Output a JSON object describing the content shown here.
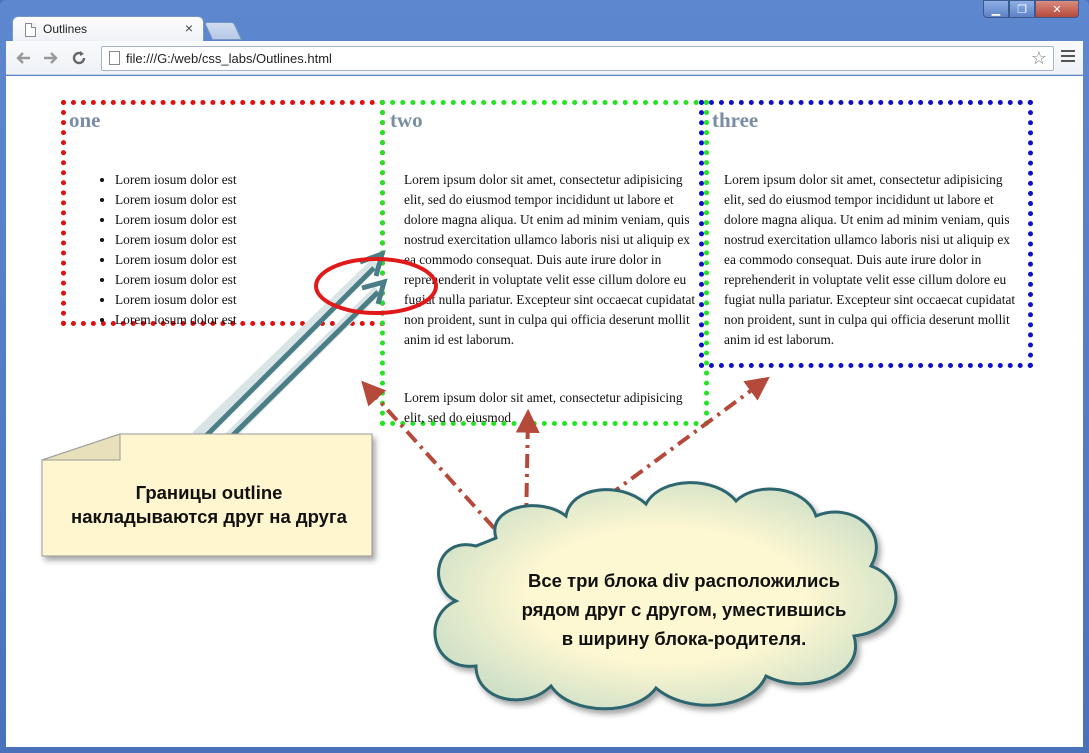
{
  "browser": {
    "tab_title": "Outlines",
    "tab_close": "×",
    "url": "file:///G:/web/css_labs/Outlines.html",
    "window_buttons": {
      "minimize": "▁",
      "maximize": "❐",
      "close": "✕"
    }
  },
  "page": {
    "one": {
      "heading": "one",
      "items": [
        "Lorem iosum dolor est",
        "Lorem iosum dolor est",
        "Lorem iosum dolor est",
        "Lorem iosum dolor est",
        "Lorem iosum dolor est",
        "Lorem iosum dolor est",
        "Lorem iosum dolor est",
        "Lorem iosum dolor est"
      ]
    },
    "two": {
      "heading": "two",
      "p1": "Lorem ipsum dolor sit amet, consectetur adipisicing elit, sed do eiusmod tempor incididunt ut labore et dolore magna aliqua. Ut enim ad minim veniam, quis nostrud exercitation ullamco laboris nisi ut aliquip ex ea commodo consequat. Duis aute irure dolor in reprehenderit in voluptate velit esse cillum dolore eu fugiat nulla pariatur. Excepteur sint occaecat cupidatat non proident, sunt in culpa qui officia deserunt mollit anim id est laborum.",
      "p2": "Lorem ipsum dolor sit amet, consectetur adipisicing elit, sed do eiusmod"
    },
    "three": {
      "heading": "three",
      "p1": "Lorem ipsum dolor sit amet, consectetur adipisicing elit, sed do eiusmod tempor incididunt ut labore et dolore magna aliqua. Ut enim ad minim veniam, quis nostrud exercitation ullamco laboris nisi ut aliquip ex ea commodo consequat. Duis aute irure dolor in reprehenderit in voluptate velit esse cillum dolore eu fugiat nulla pariatur. Excepteur sint occaecat cupidatat non proident, sunt in culpa qui officia deserunt mollit anim id est laborum."
    }
  },
  "annotations": {
    "note_line1": "Границы outline",
    "note_line2": "накладываются друг на друга",
    "cloud_line1": "Все три блока div расположились",
    "cloud_line2": "рядом друг с другом, уместившись",
    "cloud_line3": "в ширину блока-родителя."
  },
  "colors": {
    "outline_one": "#e01010",
    "outline_two": "#22e522",
    "outline_three": "#1010c8",
    "heading": "#7a8da4",
    "note_fill": "#fff6cf",
    "cloud_fill": "#fdf7d2",
    "cloud_stroke": "#2e6670",
    "arrow_teal": "#4a7d86",
    "arrow_red": "#b5493a",
    "ellipse_red": "#e01a1a"
  }
}
